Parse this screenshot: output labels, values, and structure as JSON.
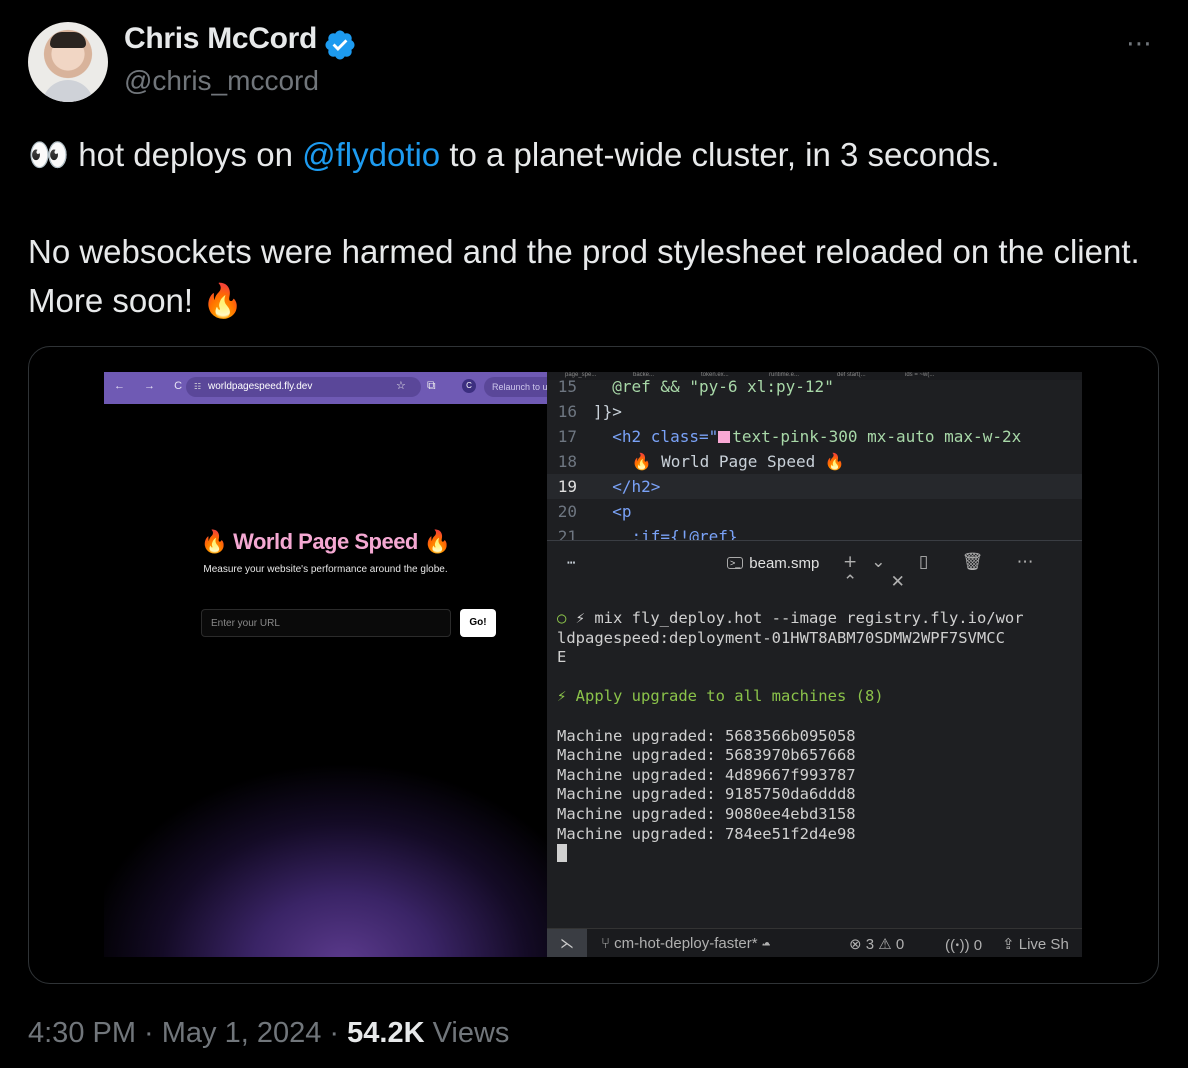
{
  "author": {
    "name": "Chris McCord",
    "handle": "@chris_mccord",
    "verified_color": "#1d9bf0"
  },
  "more_icon": "⋯",
  "tweet": {
    "line1_prefix": "👀 hot deploys on ",
    "mention": "@flydotio",
    "line1_suffix": " to a planet-wide cluster, in 3 seconds.",
    "line2": "No websockets were harmed and the prod stylesheet reloaded on the client. More soon! 🔥"
  },
  "browser": {
    "nav": "← → C",
    "url": "worldpagespeed.fly.dev",
    "profile": "C",
    "relaunch": "Relaunch to u",
    "page_title": "🔥 World Page Speed 🔥",
    "page_subtitle": "Measure your website's performance around the globe.",
    "input_placeholder": "Enter your URL",
    "go_button": "Go!"
  },
  "editor": {
    "tabs": [
      "page_spe...",
      "backe...",
      "token.ex...",
      "runtime.e...",
      "def start(...",
      "ids = ~w(..."
    ],
    "lines": [
      {
        "n": "15",
        "text": "  @ref && \"py-6 xl:py-12\""
      },
      {
        "n": "16",
        "text": "]}>"
      },
      {
        "n": "17",
        "pre": "  <h2 class=\"",
        "post": "text-pink-300 mx-auto max-w-2x"
      },
      {
        "n": "18",
        "text": "    🔥 World Page Speed 🔥"
      },
      {
        "n": "19",
        "text": "  </h2>"
      },
      {
        "n": "20",
        "text": "  <p"
      },
      {
        "n": "21",
        "text": "    :if={!@ref}"
      }
    ]
  },
  "terminal": {
    "dots": "⋯",
    "process": "beam.smp",
    "command": "⚡ mix fly_deploy.hot --image registry.fly.io/wor\nldpagespeed:deployment-01HWT8ABM70SDMW2WPF7SVMCC\nE",
    "apply": "⚡ Apply upgrade to all machines (8)",
    "machines": [
      "Machine upgraded: 5683566b095058",
      "Machine upgraded: 5683970b657668",
      "Machine upgraded: 4d89667f993787",
      "Machine upgraded: 9185750da6ddd8",
      "Machine upgraded: 9080ee4ebd3158",
      "Machine upgraded: 784ee51f2d4e98"
    ]
  },
  "statusbar": {
    "branch": "cm-hot-deploy-faster*",
    "errors": "⊗ 3 ⚠ 0",
    "ports": "0",
    "live": "Live Sh"
  },
  "footer": {
    "time": "4:30 PM · May 1, 2024 · ",
    "views_count": "54.2K",
    "views_label": " Views"
  }
}
